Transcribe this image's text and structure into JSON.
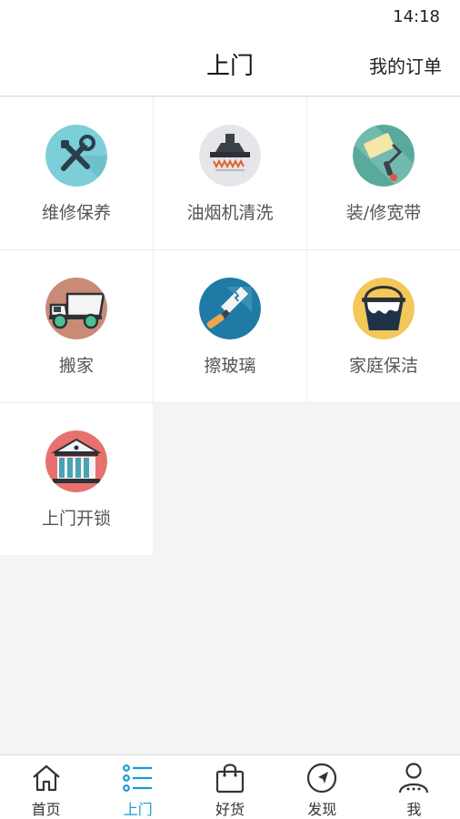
{
  "status_bar": {
    "time": "14:18"
  },
  "header": {
    "title": "上门",
    "my_orders": "我的订单"
  },
  "services": [
    {
      "label": "维修保养",
      "icon": "wrench-screwdriver-icon",
      "color": "#7ccfd8"
    },
    {
      "label": "油烟机清洗",
      "icon": "range-hood-icon",
      "color": "#e6e6ea"
    },
    {
      "label": "装/修宽带",
      "icon": "paint-roller-icon",
      "color": "#5aa99d"
    },
    {
      "label": "搬家",
      "icon": "truck-icon",
      "color": "#c98a76"
    },
    {
      "label": "擦玻璃",
      "icon": "window-cleaning-icon",
      "color": "#1f7ba6"
    },
    {
      "label": "家庭保洁",
      "icon": "cleaning-bucket-icon",
      "color": "#f3c75a"
    },
    {
      "label": "上门开锁",
      "icon": "building-icon",
      "color": "#e7716e"
    }
  ],
  "tabbar": {
    "active_color": "#1a9ad6",
    "items": [
      {
        "label": "首页",
        "icon": "home-icon"
      },
      {
        "label": "上门",
        "icon": "list-icon",
        "active": true
      },
      {
        "label": "好货",
        "icon": "shopping-bag-icon"
      },
      {
        "label": "发现",
        "icon": "compass-icon"
      },
      {
        "label": "我",
        "icon": "user-icon"
      }
    ]
  }
}
